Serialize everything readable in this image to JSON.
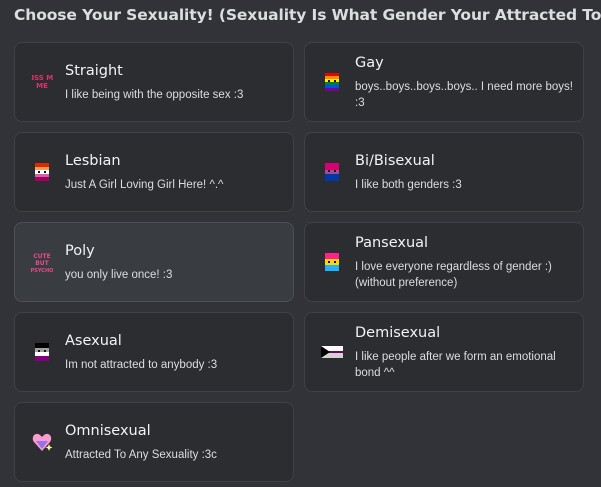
{
  "heading": "Choose Your Sexuality! (Sexuality Is What Gender Your Attracted To!)",
  "options": [
    {
      "title": "Straight",
      "description": "I like being with the opposite sex :3",
      "icon": "kiss-me-icon",
      "icon_text": "KISS ME"
    },
    {
      "title": "Gay",
      "description": "boys..boys..boys..boys.. I need more boys! :3",
      "icon": "rainbow-pride-character-icon"
    },
    {
      "title": "Lesbian",
      "description": "Just A Girl Loving Girl Here! ^.^",
      "icon": "lesbian-pride-character-icon"
    },
    {
      "title": "Bi/Bisexual",
      "description": "I like both genders :3",
      "icon": "bisexual-pride-character-icon"
    },
    {
      "title": "Poly",
      "description": "you only live once! :3",
      "icon": "cute-but-psycho-icon",
      "icon_text": "CUTE BUT PSYCHO"
    },
    {
      "title": "Pansexual",
      "description": "I love everyone regardless of gender :) (without preference)",
      "icon": "pansexual-pride-character-icon"
    },
    {
      "title": "Asexual",
      "description": "Im not attracted to anybody :3",
      "icon": "asexual-pride-character-icon"
    },
    {
      "title": "Demisexual",
      "description": "I like people after we form an emotional bond ^^",
      "icon": "demisexual-flag-icon"
    },
    {
      "title": "Omnisexual",
      "description": "Attracted To Any Sexuality :3c",
      "icon": "sparkle-heart-icon"
    }
  ],
  "colors": {
    "background": "#313338",
    "card": "#2b2d31",
    "card_active": "#393c41",
    "border": "#3f4147"
  }
}
